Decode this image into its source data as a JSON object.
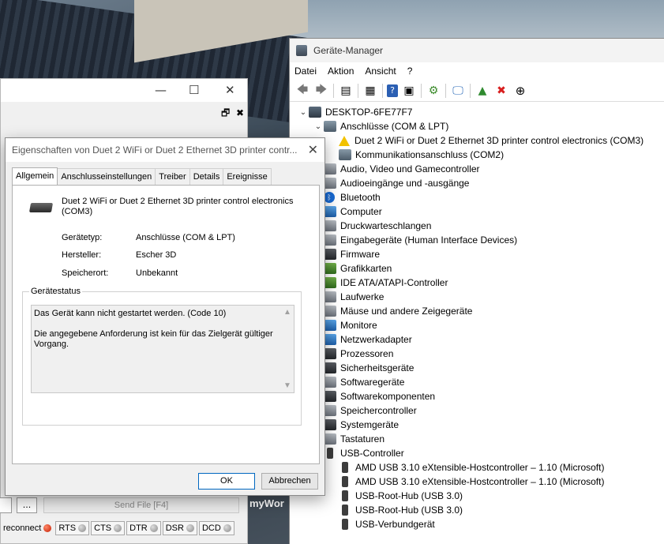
{
  "device_manager": {
    "title": "Geräte-Manager",
    "menu": [
      "Datei",
      "Aktion",
      "Ansicht",
      "?"
    ],
    "tree": [
      {
        "level": 0,
        "expand": "v",
        "icon": "computer-icon",
        "label": "DESKTOP-6FE77F7"
      },
      {
        "level": 1,
        "expand": "v",
        "icon": "port-icon",
        "label": "Anschlüsse (COM & LPT)"
      },
      {
        "level": 2,
        "expand": "",
        "icon": "warning-icon",
        "label": "Duet 2 WiFi or Duet 2 Ethernet 3D printer control electronics (COM3)"
      },
      {
        "level": 2,
        "expand": "",
        "icon": "port-icon",
        "label": "Kommunikationsanschluss (COM2)"
      },
      {
        "level": 1,
        "expand": ">",
        "icon": "audio-icon",
        "label": "Audio, Video und Gamecontroller"
      },
      {
        "level": 1,
        "expand": ">",
        "icon": "audio-icon",
        "label": "Audioeingänge und -ausgänge"
      },
      {
        "level": 1,
        "expand": ">",
        "icon": "bluetooth-icon",
        "label": "Bluetooth"
      },
      {
        "level": 1,
        "expand": ">",
        "icon": "monitor-icon",
        "label": "Computer"
      },
      {
        "level": 1,
        "expand": ">",
        "icon": "printer-icon",
        "label": "Druckwarteschlangen"
      },
      {
        "level": 1,
        "expand": ">",
        "icon": "keyboard-icon",
        "label": "Eingabegeräte (Human Interface Devices)"
      },
      {
        "level": 1,
        "expand": ">",
        "icon": "chip-icon",
        "label": "Firmware"
      },
      {
        "level": 1,
        "expand": ">",
        "icon": "graphics-card-icon",
        "label": "Grafikkarten"
      },
      {
        "level": 1,
        "expand": ">",
        "icon": "ide-icon",
        "label": "IDE ATA/ATAPI-Controller"
      },
      {
        "level": 1,
        "expand": ">",
        "icon": "drive-icon",
        "label": "Laufwerke"
      },
      {
        "level": 1,
        "expand": ">",
        "icon": "mouse-icon",
        "label": "Mäuse und andere Zeigegeräte"
      },
      {
        "level": 1,
        "expand": ">",
        "icon": "monitor-icon",
        "label": "Monitore"
      },
      {
        "level": 1,
        "expand": ">",
        "icon": "network-icon",
        "label": "Netzwerkadapter"
      },
      {
        "level": 1,
        "expand": ">",
        "icon": "chip-icon",
        "label": "Prozessoren"
      },
      {
        "level": 1,
        "expand": ">",
        "icon": "security-icon",
        "label": "Sicherheitsgeräte"
      },
      {
        "level": 1,
        "expand": ">",
        "icon": "software-icon",
        "label": "Softwaregeräte"
      },
      {
        "level": 1,
        "expand": ">",
        "icon": "component-icon",
        "label": "Softwarekomponenten"
      },
      {
        "level": 1,
        "expand": ">",
        "icon": "storage-icon",
        "label": "Speichercontroller"
      },
      {
        "level": 1,
        "expand": ">",
        "icon": "chip-icon",
        "label": "Systemgeräte"
      },
      {
        "level": 1,
        "expand": ">",
        "icon": "keyboard-icon",
        "label": "Tastaturen"
      },
      {
        "level": 1,
        "expand": "v",
        "icon": "usb-icon",
        "label": "USB-Controller"
      },
      {
        "level": 2,
        "expand": "",
        "icon": "usb-icon",
        "label": "AMD USB 3.10 eXtensible-Hostcontroller – 1.10 (Microsoft)"
      },
      {
        "level": 2,
        "expand": "",
        "icon": "usb-icon",
        "label": "AMD USB 3.10 eXtensible-Hostcontroller – 1.10 (Microsoft)"
      },
      {
        "level": 2,
        "expand": "",
        "icon": "usb-icon",
        "label": "USB-Root-Hub (USB 3.0)"
      },
      {
        "level": 2,
        "expand": "",
        "icon": "usb-icon",
        "label": "USB-Root-Hub (USB 3.0)"
      },
      {
        "level": 2,
        "expand": "",
        "icon": "usb-icon",
        "label": "USB-Verbundgerät"
      }
    ]
  },
  "properties": {
    "title": "Eigenschaften von Duet 2 WiFi or Duet 2 Ethernet 3D printer contr...",
    "tabs": [
      "Allgemein",
      "Anschlusseinstellungen",
      "Treiber",
      "Details",
      "Ereignisse"
    ],
    "device_name": "Duet 2 WiFi or Duet 2 Ethernet 3D printer control electronics (COM3)",
    "fields": [
      {
        "key": "Gerätetyp:",
        "value": "Anschlüsse (COM & LPT)"
      },
      {
        "key": "Hersteller:",
        "value": "Escher 3D"
      },
      {
        "key": "Speicherort:",
        "value": "Unbekannt"
      }
    ],
    "status_legend": "Gerätestatus",
    "status_line1": "Das Gerät kann nicht gestartet werden. (Code 10)",
    "status_line2": "Die angegebene Anforderung ist kein für das Zielgerät gültiger Vorgang.",
    "ok_label": "OK",
    "cancel_label": "Abbrechen"
  },
  "terminal": {
    "dots_label": "...",
    "send_file_label": "Send File [F4]",
    "reconnect_label": "reconnect",
    "signals": [
      "RTS",
      "CTS",
      "DTR",
      "DSR",
      "DCD"
    ],
    "corner_text": "myWor"
  }
}
